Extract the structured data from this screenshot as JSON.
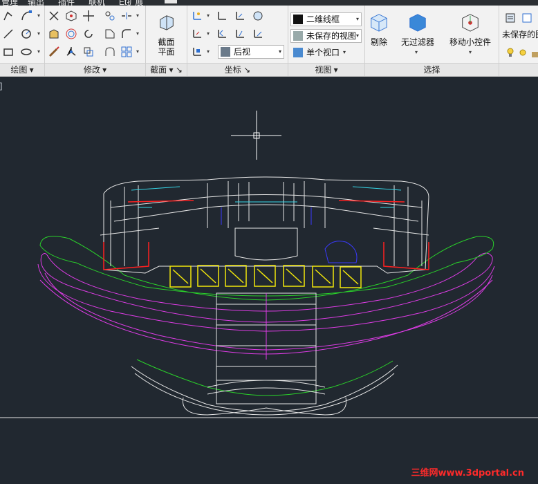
{
  "ribbon_tabs": [
    "管理",
    "输出",
    "插件",
    "联机",
    "Et扩展"
  ],
  "panels": {
    "draw": {
      "title": "绘图"
    },
    "modify": {
      "title": "修改"
    },
    "section": {
      "title": "截面",
      "plane_label": "截面\n平面"
    },
    "coords": {
      "title": "坐标"
    },
    "view": {
      "title": "视图",
      "visual_style": "二维线框",
      "saved_view": "未保存的视图",
      "back_view": "后视",
      "single_viewport": "单个视口"
    },
    "select": {
      "title": "选择",
      "cull": "剔除",
      "no_filter": "无过滤器",
      "move_gizmo": "移动小控件"
    },
    "cut": {
      "saved_layer": "未保存的图"
    }
  },
  "file_tab": "]",
  "watermark": "三维网www.3dportal.cn",
  "colors": {
    "background": "#212830",
    "ribbon": "#f2f2f2",
    "watermark": "#ff2a2a"
  }
}
